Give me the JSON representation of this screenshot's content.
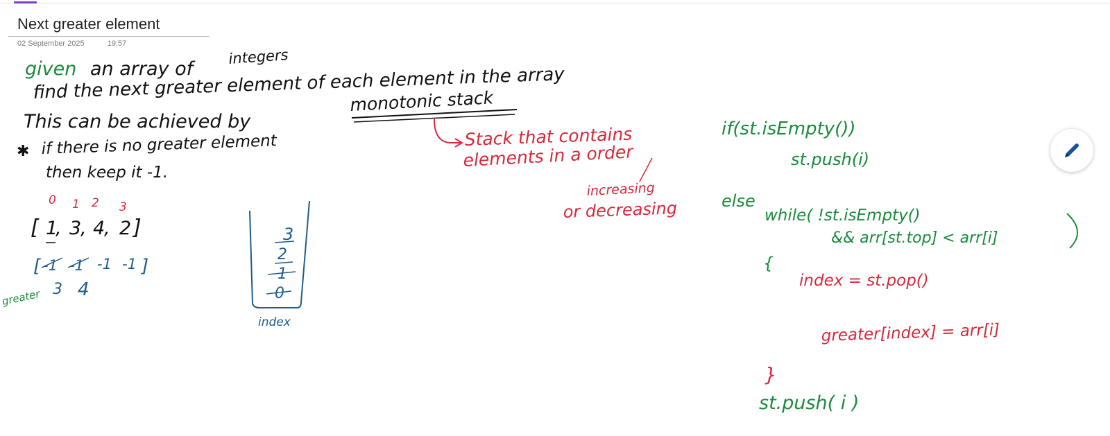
{
  "page": {
    "title": "Next greater element",
    "date": "02 September 2025",
    "time": "19:57"
  },
  "colors": {
    "ink_black": "#111111",
    "ink_red": "#d8283a",
    "ink_green": "#1a8a3c",
    "ink_blue": "#1f5c8f",
    "accent": "#7a3cc4"
  },
  "notes": {
    "intro": {
      "line1_prefix": "given",
      "line1_rest": "an array of",
      "line1_super": "integers",
      "line2": "find the next greater element of each element in the array",
      "line3": "This can be achieved by",
      "line3_link": "monotonic stack",
      "line4": "if there is no greater element",
      "line5": "then keep it -1."
    },
    "stack_note": {
      "line1": "Stack that contains",
      "line2": "elements in a order",
      "option1": "increasing",
      "option2": "or decreasing"
    },
    "example": {
      "indices": [
        "0",
        "1",
        "2",
        "3"
      ],
      "array_open": "[",
      "array_values": [
        "1",
        "3",
        "4",
        "2"
      ],
      "array_close": "]",
      "result_open": "[",
      "result_values": [
        "-1",
        "-1",
        "-1",
        "-1"
      ],
      "result_close": "]",
      "greater_label": "greater",
      "greater_values": [
        "3",
        "4"
      ]
    },
    "stack_diagram": {
      "entries": [
        "3",
        "2",
        "1",
        "0"
      ],
      "label": "index"
    },
    "code": {
      "if_line": "if(st.isEmpty())",
      "push_line": "st.push(i)",
      "else_kw": "else",
      "while_line": "while( !st.isEmpty()",
      "cond_line": "&& arr[st.top] < arr[i]",
      "open_brace": "{",
      "index_line": "index = st.pop()",
      "greater_line": "greater[index] = arr[i]",
      "close_brace": "}",
      "final_push": "st.push( i )"
    }
  },
  "toolbar": {
    "pen_icon": "pen-icon"
  }
}
